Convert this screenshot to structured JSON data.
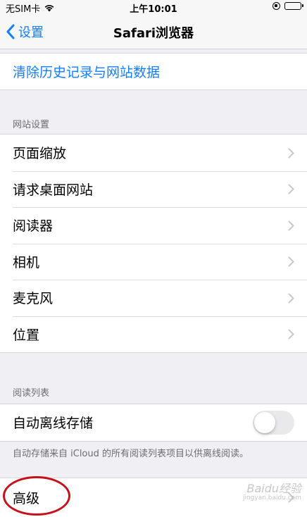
{
  "status_bar": {
    "carrier": "无SIM卡",
    "time": "上午10:01"
  },
  "nav": {
    "back_label": "设置",
    "title": "Safari浏览器"
  },
  "clear_history": {
    "label": "清除历史记录与网站数据"
  },
  "website_settings": {
    "header": "网站设置",
    "items": [
      {
        "label": "页面缩放"
      },
      {
        "label": "请求桌面网站"
      },
      {
        "label": "阅读器"
      },
      {
        "label": "相机"
      },
      {
        "label": "麦克风"
      },
      {
        "label": "位置"
      }
    ]
  },
  "reading_list": {
    "header": "阅读列表",
    "auto_offline_label": "自动离线存储",
    "auto_offline_enabled": false,
    "footer": "自动存储来自 iCloud 的所有阅读列表项目以供离线阅读。"
  },
  "advanced": {
    "label": "高级"
  },
  "watermark": {
    "text": "Baidu经验",
    "sub": "jingyan.baidu.com"
  },
  "colors": {
    "accent": "#147efb",
    "background": "#efeff4",
    "highlight": "#c4121a"
  }
}
